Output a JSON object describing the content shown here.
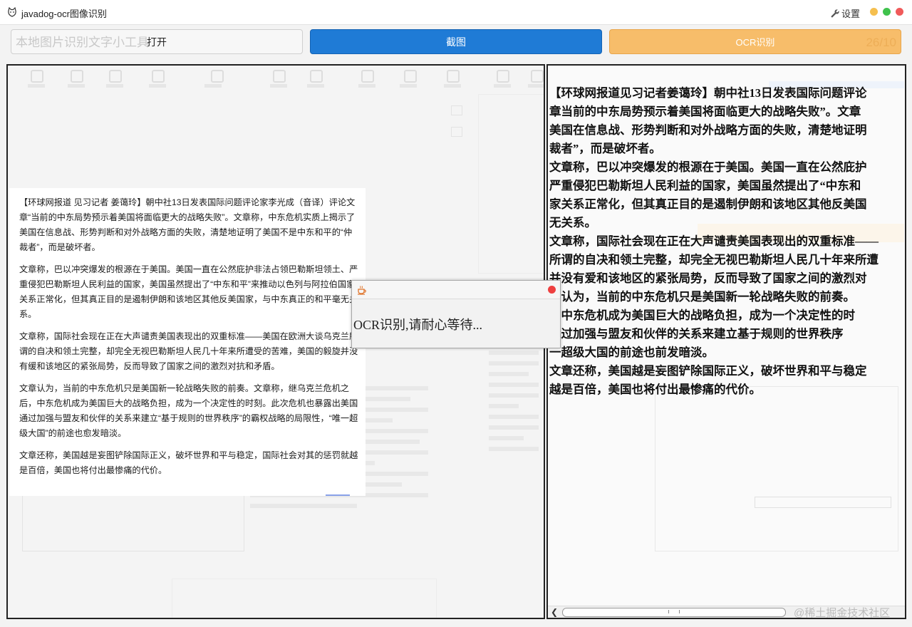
{
  "window": {
    "title": "javadog-ocr图像识别",
    "settings_label": "设置",
    "controls": [
      "minimize",
      "maximize",
      "close"
    ],
    "control_colors": {
      "minimize": "#f5bf4f",
      "maximize": "#3fc24c",
      "close": "#f05a5a"
    }
  },
  "toolbar": {
    "open_label": "打开",
    "open_ghost_text": "本地图片识别文字小工具",
    "capture_label": "截图",
    "ocr_label": "OCR识别",
    "ocr_ghost_text": "26/10",
    "colors": {
      "capture": "#1f7bd6",
      "ocr": "#f7bd6a"
    }
  },
  "left_pane": {
    "paragraphs": [
      "【环球网报道 见习记者 姜蔼玲】朝中社13日发表国际问题评论家李光成（音译）评论文章“当前的中东局势预示着美国将面临更大的战略失败”。文章称，中东危机实质上揭示了美国在信息战、形势判断和对外战略方面的失败，清楚地证明了美国不是中东和平的“仲裁者”，而是破坏者。",
      "文章称，巴以冲突爆发的根源在于美国。美国一直在公然庇护非法占领巴勒斯坦领土、严重侵犯巴勒斯坦人民利益的国家，美国虽然提出了“中东和平”来推动以色列与阿拉伯国家关系正常化，但其真正目的是遏制伊朗和该地区其他反美国家，与中东真正的和平毫无关系。",
      "文章称，国际社会现在正在大声谴责美国表现出的双重标准——美国在欧洲大谈乌克兰所谓的自决和领土完整，却完全无视巴勒斯坦人民几十年来所遭受的苦难，美国的毅旋并没有缓和该地区的紧张局势，反而导致了国家之间的激烈对抗和矛盾。",
      "文章认为，当前的中东危机只是美国新一轮战略失败的前奏。文章称，继乌克兰危机之后，中东危机成为美国巨大的战略负担，成为一个决定性的时刻。此次危机也暴露出美国通过加强与盟友和伙伴的关系来建立“基于规则的世界秩序”的霸权战略的局限性，“唯一超级大国”的前途也愈发暗淡。",
      "文章还称，美国越是妄图铲除国际正义，破坏世界和平与稳定，国际社会对其的惩罚就越是百倍，美国也将付出最惨痛的代价。"
    ]
  },
  "right_pane": {
    "lines": [
      "【环球网报道见习记者姜蔼玲】朝中社13日发表国际问题评论",
      "章当前的中东局势预示着美国将面临更大的战略失败”。文章",
      "美国在信息战、形势判断和对外战略方面的失败，清楚地证明",
      "裁者”，而是破坏者。",
      "文章称，巴以冲突爆发的根源在于美国。美国一直在公然庇护",
      "严重侵犯巴勒斯坦人民利益的国家，美国虽然提出了“中东和",
      "家关系正常化，但其真正目的是遏制伊朗和该地区其他反美国",
      "无关系。",
      "文章称，国际社会现在正在大声谴责美国表现出的双重标准——",
      "所谓的自决和领土完整，却完全无视巴勒斯坦人民几十年来所遭",
      "并没有爱和该地区的紧张局势，反而导致了国家之间的激烈对",
      "章认为，当前的中东危机只是美国新一轮战略失败的前奏。",
      "，中东危机成为美国巨大的战略负担，成为一个决定性的时",
      "通过加强与盟友和伙伴的关系来建立基于规则的世界秩序",
      "一超级大国的前途也前发暗淡。",
      "文章还称，美国越是妄图铲除国际正义，破坏世界和平与稳定",
      "越是百倍，美国也将付出最惨痛的代价。"
    ],
    "watermark": "@稀土掘金技术社区"
  },
  "dialog": {
    "message": "OCR识别,请耐心等待..."
  }
}
